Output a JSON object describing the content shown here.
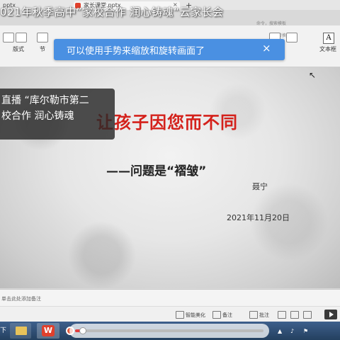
{
  "tabs": {
    "tab1": "pptx",
    "tab2": "家长课堂.pptx",
    "close": "×",
    "add": "+"
  },
  "banner": {
    "title": "021年秋季高中”家校合作 润心铸魂“云家长会"
  },
  "ribbon": {
    "search_hint": "命令，搜索模板",
    "convert": "转换",
    "layout": "版式",
    "section": "节",
    "textbox": "文本框",
    "textbox_icon": "A"
  },
  "toast": {
    "text": "可以使用手势来缩放和旋转画面了",
    "close": "×"
  },
  "slide": {
    "title": "让孩子因您而不同",
    "subtitle": "——问题是“褶皱”",
    "author": "聂宁",
    "date": "2021年11月20日"
  },
  "live": {
    "line1": "直播 “库尔勒市第二",
    "line2": "校合作 润心铸魂"
  },
  "notes": {
    "placeholder": "单击此处添加备注"
  },
  "status": {
    "smart": "智能美化",
    "notes": "备注",
    "comment": "批注"
  },
  "video": {
    "progress": 0.04
  },
  "taskbar": {
    "wps": "W",
    "start": "下"
  },
  "colors": {
    "slide_title": "#d4211b",
    "toast": "#4a90e2",
    "progress": "#e23c3c"
  }
}
